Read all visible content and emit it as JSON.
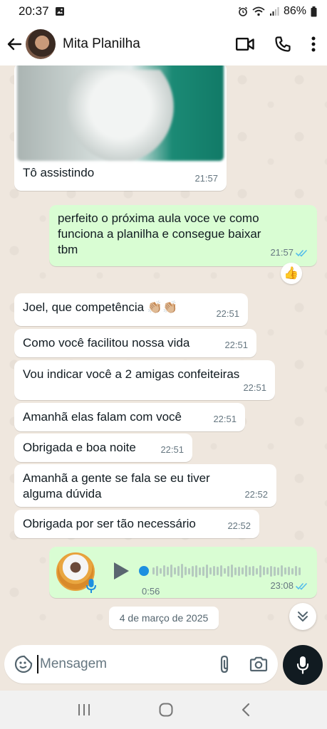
{
  "status_bar": {
    "time": "20:37",
    "battery": "86%"
  },
  "header": {
    "contact_name": "Mita Planilha"
  },
  "messages": [
    {
      "direction": "in",
      "text": "Tô assistindo",
      "time": "21:57",
      "has_image": true
    },
    {
      "direction": "out",
      "lines": [
        "perfeito o próxima aula voce ve como",
        "funciona a planilha e consegue baixar",
        "tbm"
      ],
      "time": "21:57",
      "read": true,
      "reaction": "👍"
    },
    {
      "direction": "in",
      "text": "Joel, que competência 👏🏼👏🏼",
      "time": "22:51"
    },
    {
      "direction": "in",
      "text": "Como você facilitou nossa vida",
      "time": "22:51"
    },
    {
      "direction": "in",
      "text": "Vou indicar você a 2 amigas confeiteiras",
      "time": "22:51"
    },
    {
      "direction": "in",
      "text": "Amanhã elas falam com você",
      "time": "22:51"
    },
    {
      "direction": "in",
      "text": "Obrigada e boa noite",
      "time": "22:51"
    },
    {
      "direction": "in",
      "lines": [
        "Amanhã a gente se fala se eu tiver",
        "alguma dúvida"
      ],
      "time": "22:52"
    },
    {
      "direction": "in",
      "text": "Obrigada por ser tão necessário",
      "time": "22:52"
    }
  ],
  "voice_message": {
    "direction": "out",
    "duration": "0:56",
    "time": "23:08",
    "read": true,
    "progress": 0
  },
  "date_chip": "4 de março de 2025",
  "composer": {
    "placeholder": "Mensagem"
  },
  "colors": {
    "outgoing_bubble": "#d9fdd3",
    "incoming_bubble": "#ffffff",
    "read_ticks": "#53bdeb",
    "chat_background": "#efe7de"
  },
  "icons": {
    "back": "arrow-left-icon",
    "video": "video-call-icon",
    "call": "phone-icon",
    "menu": "more-vertical-icon",
    "sticker": "sticker-icon",
    "attach": "paperclip-icon",
    "camera": "camera-icon",
    "mic": "microphone-icon"
  }
}
